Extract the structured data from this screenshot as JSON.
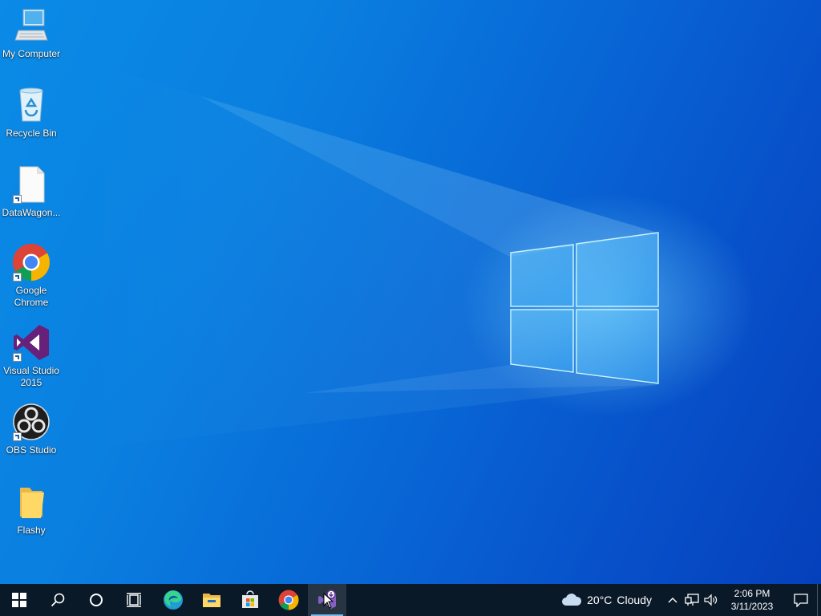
{
  "desktop": {
    "icons": [
      {
        "label": "My Computer",
        "icon": "computer-icon"
      },
      {
        "label": "Recycle Bin",
        "icon": "recycle-bin-icon"
      },
      {
        "label": "DataWagon...",
        "icon": "file-icon"
      },
      {
        "label": "Google Chrome",
        "icon": "chrome-icon"
      },
      {
        "label": "Visual Studio 2015",
        "icon": "visual-studio-icon"
      },
      {
        "label": "OBS Studio",
        "icon": "obs-icon"
      },
      {
        "label": "Flashy",
        "icon": "folder-icon"
      }
    ],
    "wallpaper_colors": {
      "light": "#0a8be6",
      "dark": "#0540bb",
      "glow": "#78dcff"
    }
  },
  "taskbar": {
    "buttons": [
      {
        "name": "start",
        "icon": "windows-logo-icon"
      },
      {
        "name": "search",
        "icon": "search-icon"
      },
      {
        "name": "cortana",
        "icon": "cortana-circle-icon"
      },
      {
        "name": "task-view",
        "icon": "task-view-icon"
      },
      {
        "name": "edge",
        "icon": "edge-icon"
      },
      {
        "name": "file-explorer",
        "icon": "folder-icon"
      },
      {
        "name": "store",
        "icon": "store-icon"
      },
      {
        "name": "chrome",
        "icon": "chrome-icon"
      },
      {
        "name": "visual-studio-installer",
        "icon": "vs-installer-icon"
      }
    ],
    "weather": {
      "temp": "20°C",
      "condition": "Cloudy",
      "icon": "cloud-icon"
    },
    "tray_icons": [
      "chevron-up-icon",
      "network-icon",
      "volume-icon"
    ],
    "clock": {
      "time": "2:06 PM",
      "date": "3/11/2023"
    },
    "notification_icon": "notification-icon",
    "background": "#0a1928"
  }
}
